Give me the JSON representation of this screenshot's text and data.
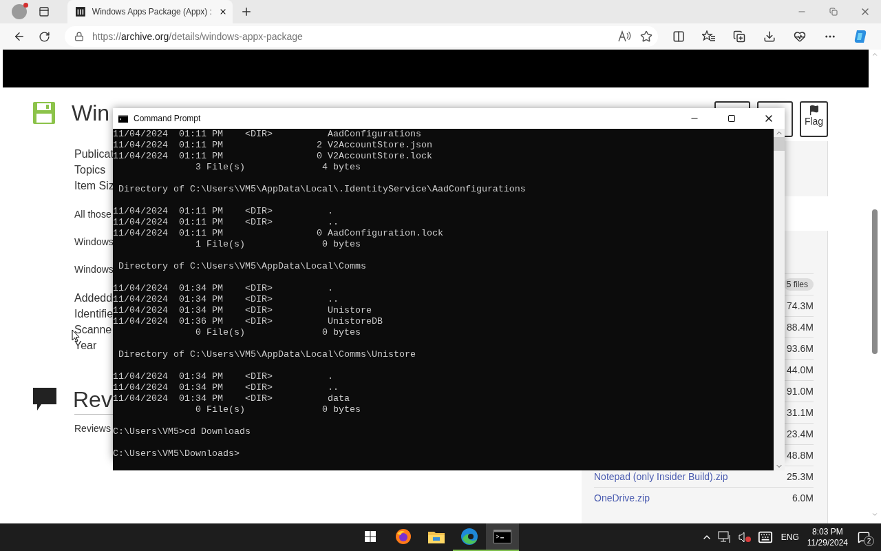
{
  "browser": {
    "tab": {
      "title": "Windows Apps Package (Appx) :",
      "selected": true
    },
    "url": {
      "scheme": "https://",
      "host": "archive.org",
      "path": "/details/windows-appx-package"
    }
  },
  "page": {
    "title": "Win",
    "details": [
      {
        "kind": "meta",
        "lines": [
          "Publicat",
          "Topics",
          "Item Siz"
        ]
      },
      {
        "kind": "note",
        "lines": [
          "All those"
        ]
      },
      {
        "kind": "note",
        "lines": [
          "Windows"
        ]
      },
      {
        "kind": "note",
        "lines": [
          "Windows"
        ]
      },
      {
        "kind": "meta",
        "lines": [
          "Addedd",
          "Identifie",
          "Scanne",
          "Year"
        ]
      }
    ],
    "reviews": {
      "title": "Rev",
      "label": "Reviews"
    },
    "actions": [
      {
        "kind": "plain"
      },
      {
        "kind": "plain"
      },
      {
        "kind": "flag",
        "label": "Flag"
      }
    ],
    "files": {
      "count": "5 files",
      "rows": [
        {
          "size": "74.3M"
        },
        {
          "size": "88.4M"
        },
        {
          "size": "93.6M"
        },
        {
          "size": "44.0M"
        },
        {
          "size": "91.0M"
        },
        {
          "size": "31.1M"
        },
        {
          "size": "23.4M"
        },
        {
          "size": "48.8M"
        },
        {
          "name": "Notepad (only Insider Build).zip",
          "size": "25.3M"
        },
        {
          "name": "OneDrive.zip",
          "size": "6.0M"
        }
      ]
    }
  },
  "console": {
    "title": "Command Prompt",
    "blocks": [
      [
        "11/04/2024  01:11 PM    <DIR>          AadConfigurations",
        "11/04/2024  01:11 PM                 2 V2AccountStore.json",
        "11/04/2024  01:11 PM                 0 V2AccountStore.lock",
        "               3 File(s)              4 bytes"
      ],
      [
        " Directory of C:\\Users\\VM5\\AppData\\Local\\.IdentityService\\AadConfigurations"
      ],
      [
        "11/04/2024  01:11 PM    <DIR>          .",
        "11/04/2024  01:11 PM    <DIR>          ..",
        "11/04/2024  01:11 PM                 0 AadConfiguration.lock",
        "               1 File(s)              0 bytes"
      ],
      [
        " Directory of C:\\Users\\VM5\\AppData\\Local\\Comms"
      ],
      [
        "11/04/2024  01:34 PM    <DIR>          .",
        "11/04/2024  01:34 PM    <DIR>          ..",
        "11/04/2024  01:34 PM    <DIR>          Unistore",
        "11/04/2024  01:36 PM    <DIR>          UnistoreDB",
        "               0 File(s)              0 bytes"
      ],
      [
        " Directory of C:\\Users\\VM5\\AppData\\Local\\Comms\\Unistore"
      ],
      [
        "11/04/2024  01:34 PM    <DIR>          .",
        "11/04/2024  01:34 PM    <DIR>          ..",
        "11/04/2024  01:34 PM    <DIR>          data",
        "               0 File(s)              0 bytes"
      ],
      [
        "C:\\Users\\VM5>cd Downloads"
      ],
      [
        "C:\\Users\\VM5\\Downloads>"
      ]
    ]
  },
  "taskbar": {
    "apps": [
      {
        "kind": "start"
      },
      {
        "kind": "firefox",
        "running": false,
        "active": false
      },
      {
        "kind": "explorer",
        "running": false,
        "active": false
      },
      {
        "kind": "edge",
        "running": true,
        "active": false
      },
      {
        "kind": "console",
        "running": true,
        "active": true
      }
    ],
    "tray": {
      "muted": true,
      "language": "ENG",
      "time": "8:03 PM",
      "date": "11/29/2024",
      "notifications": "2"
    }
  }
}
